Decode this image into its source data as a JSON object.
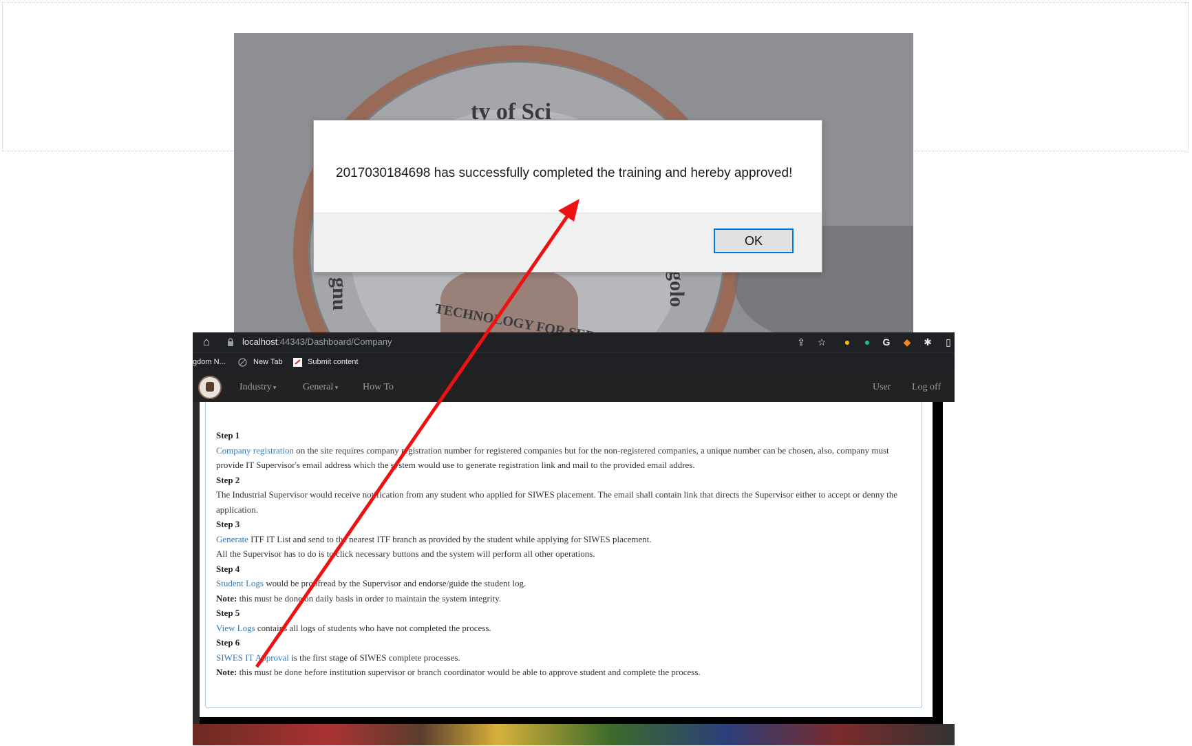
{
  "dialog": {
    "message": "2017030184698 has successfully completed the training and hereby approved!",
    "ok_label": "OK"
  },
  "background_seal": {
    "text_top": "ty of Sci",
    "text_left": "gnu",
    "text_right": "golo",
    "motto": "TECHNOLOGY FOR SER"
  },
  "browser": {
    "url_host": "localhost",
    "url_path": ":44343/Dashboard/Company",
    "bookmarks": [
      "gdom N...",
      "New Tab",
      "Submit content"
    ]
  },
  "navbar": {
    "items": [
      "Industry",
      "General",
      "How To"
    ],
    "right_items": [
      "User",
      "Log off"
    ]
  },
  "steps": [
    {
      "title": "Step 1",
      "link": "Company registration",
      "text": " on the site requires company registration number for registered companies but for the non-registered companies, a unique number can be chosen, also, company must provide IT Supervisor's email address which the system would use to generate registration link and mail to the provided email addres."
    },
    {
      "title": "Step 2",
      "text": "The Industrial Supervisor would receive notification from any student who applied for SIWES placement. The email shall contain link that directs the Supervisor either to accept or denny the application."
    },
    {
      "title": "Step 3",
      "link": "Generate",
      "text": " ITF IT List and send to the nearest ITF branch as provided by the student while applying for SIWES placement.",
      "text2": "All the Supervisor has to do is to click necessary buttons and the system will perform all other operations."
    },
    {
      "title": "Step 4",
      "link": "Student Logs",
      "text": " would be proofread by the Supervisor and endorse/guide the student log.",
      "note_label": "Note:",
      "note": " this must be done on daily basis in order to maintain the system integrity."
    },
    {
      "title": "Step 5",
      "link": "View Logs",
      "text": " contains all logs of students who have not completed the process."
    },
    {
      "title": "Step 6",
      "link": "SIWES IT Approval",
      "text": " is the first stage of SIWES complete processes.",
      "note_label": "Note:",
      "note": " this must be done before institution supervisor or branch coordinator would be able to approve student and complete the process."
    }
  ],
  "colors": {
    "arrow": "#ee1111",
    "link": "#337ab7",
    "navbar": "#222222",
    "ok_border": "#0078d7"
  }
}
